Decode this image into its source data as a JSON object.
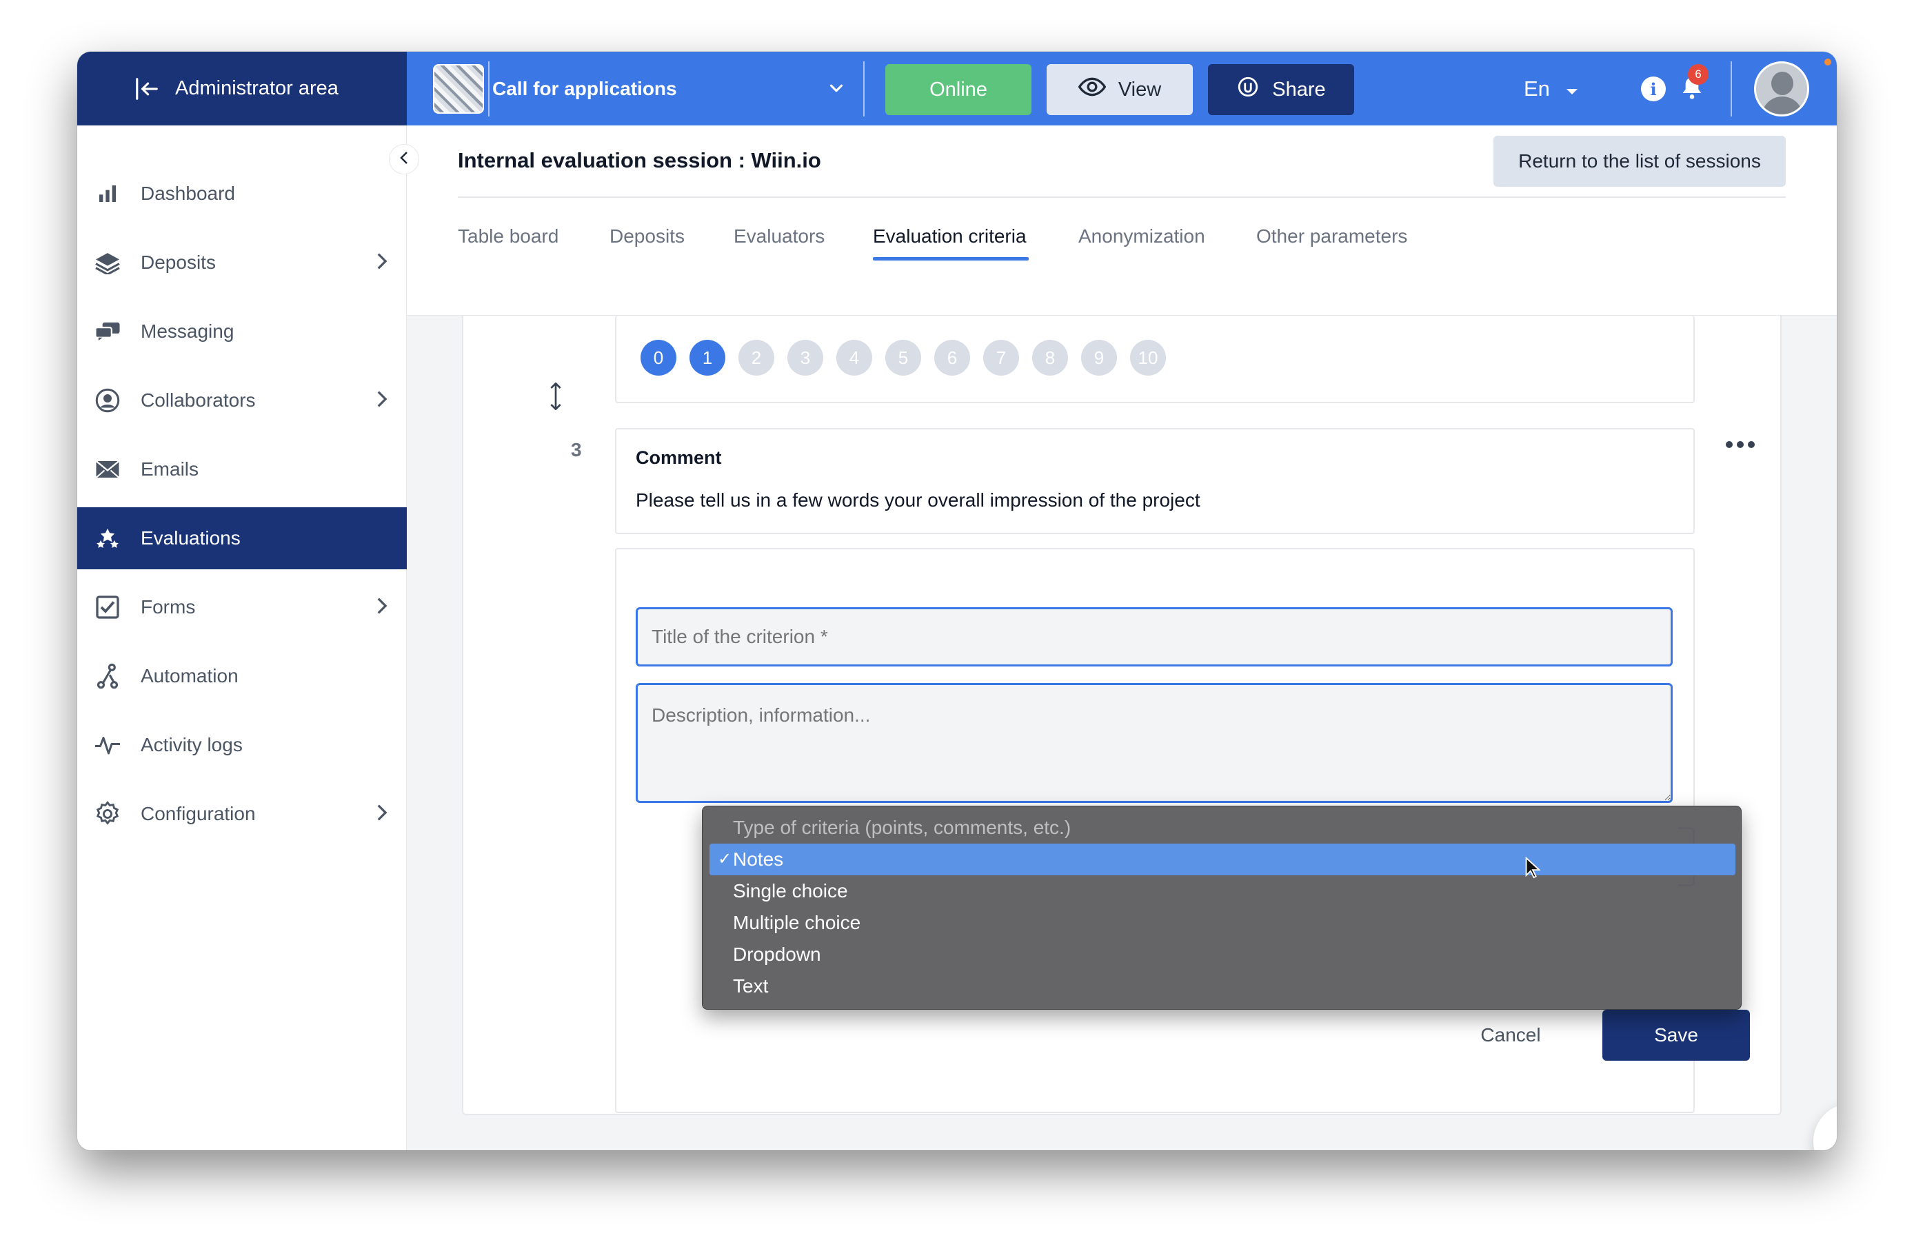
{
  "topbar": {
    "admin_label": "Administrator area",
    "app_title": "Call for applications",
    "online_label": "Online",
    "view_label": "View",
    "share_label": "Share",
    "language": "En",
    "notification_count": "6"
  },
  "sidebar": {
    "items": [
      {
        "label": "Dashboard",
        "icon": "bar-chart-icon"
      },
      {
        "label": "Deposits",
        "icon": "layers-icon"
      },
      {
        "label": "Messaging",
        "icon": "chat-icon"
      },
      {
        "label": "Collaborators",
        "icon": "user-circle-icon"
      },
      {
        "label": "Emails",
        "icon": "envelope-icon"
      },
      {
        "label": "Evaluations",
        "icon": "stars-icon"
      },
      {
        "label": "Forms",
        "icon": "checkbox-icon"
      },
      {
        "label": "Automation",
        "icon": "automation-icon"
      },
      {
        "label": "Activity logs",
        "icon": "activity-icon"
      },
      {
        "label": "Configuration",
        "icon": "gear-icon"
      }
    ],
    "active": "Evaluations"
  },
  "header": {
    "title": "Internal evaluation session : Wiin.io",
    "return_label": "Return to the list of sessions",
    "tabs": [
      "Table board",
      "Deposits",
      "Evaluators",
      "Evaluation criteria",
      "Anonymization",
      "Other parameters"
    ],
    "active_tab": "Evaluation criteria"
  },
  "scale": {
    "values": [
      "0",
      "1",
      "2",
      "3",
      "4",
      "5",
      "6",
      "7",
      "8",
      "9",
      "10"
    ],
    "selected_up_to": 1
  },
  "criterion": {
    "number": "3",
    "title": "Comment",
    "description": "Please tell us in a few words your overall impression of the project"
  },
  "form": {
    "title_placeholder": "Title of the criterion *",
    "description_placeholder": "Description, information...",
    "cancel_label": "Cancel",
    "save_label": "Save"
  },
  "dropdown": {
    "placeholder": "Type of criteria (points, comments, etc.)",
    "options": [
      "Notes",
      "Single choice",
      "Multiple choice",
      "Dropdown",
      "Text"
    ],
    "selected": "Notes",
    "check": "✓"
  },
  "fab": {
    "glyph": "✌"
  },
  "colors": {
    "primary": "#3b78e6",
    "navy": "#1a3376",
    "online": "#5cc47c",
    "badge": "#e5483b"
  }
}
